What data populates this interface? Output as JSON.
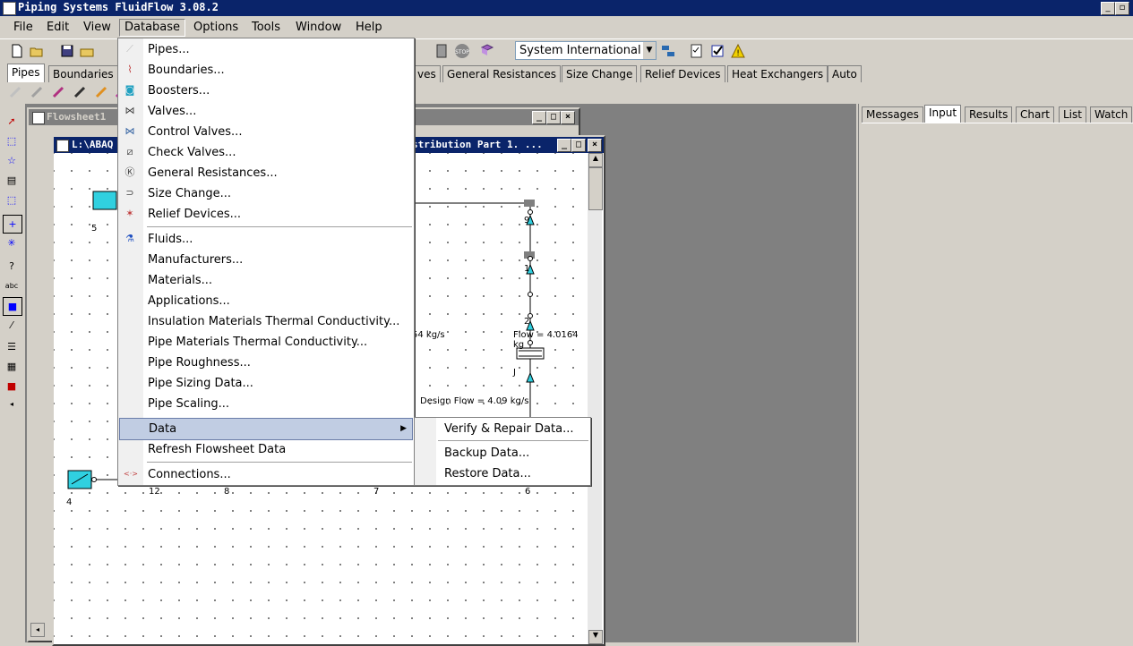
{
  "app": {
    "title": "Piping Systems FluidFlow 3.08.2"
  },
  "menubar": {
    "items": [
      "File",
      "Edit",
      "View",
      "Database",
      "Options",
      "Tools",
      "Window",
      "Help"
    ]
  },
  "toolbar": {
    "units_value": "System International"
  },
  "component_tabs": [
    "Pipes",
    "Boundaries",
    "ves",
    "General Resistances",
    "Size Change",
    "Relief Devices",
    "Heat Exchangers",
    "Auto"
  ],
  "flowsheet1": {
    "title": "Flowsheet1"
  },
  "flowsheet2": {
    "title_left": "L:\\ABAQ",
    "title_right": "stribution Part 1. ...",
    "labels": {
      "n5": "5",
      "n9": "9",
      "n1": "1",
      "n2": "2",
      "nJ": "J",
      "flow_a": "54 kg/s",
      "flow_b": "Flow = 4.0164 kg",
      "design_flow": "Design Flow = 4.09 kg/s",
      "n4": "4",
      "n12": "12",
      "n8": "8",
      "n7": "7",
      "n6": "6"
    }
  },
  "right_panel": {
    "tabs": [
      "Messages",
      "Input",
      "Results",
      "Chart",
      "List",
      "Watch"
    ]
  },
  "database_menu": {
    "items": [
      {
        "label": "Pipes...",
        "icon": "pipe-icon"
      },
      {
        "label": "Boundaries...",
        "icon": "boundary-icon"
      },
      {
        "label": "Boosters...",
        "icon": "booster-icon"
      },
      {
        "label": "Valves...",
        "icon": "valve-icon"
      },
      {
        "label": "Control Valves...",
        "icon": "control-valve-icon"
      },
      {
        "label": "Check Valves...",
        "icon": "check-valve-icon"
      },
      {
        "label": "General Resistances...",
        "icon": "resistance-icon"
      },
      {
        "label": "Size Change...",
        "icon": "size-change-icon"
      },
      {
        "label": "Relief Devices...",
        "icon": "relief-icon"
      },
      {
        "label": "Fluids...",
        "icon": "fluid-icon"
      },
      {
        "label": "Manufacturers...",
        "icon": ""
      },
      {
        "label": "Materials...",
        "icon": ""
      },
      {
        "label": "Applications...",
        "icon": ""
      },
      {
        "label": "Insulation Materials Thermal Conductivity...",
        "icon": ""
      },
      {
        "label": "Pipe Materials Thermal Conductivity...",
        "icon": ""
      },
      {
        "label": "Pipe Roughness...",
        "icon": ""
      },
      {
        "label": "Pipe Sizing Data...",
        "icon": ""
      },
      {
        "label": "Pipe Scaling...",
        "icon": ""
      },
      {
        "label": "Data",
        "icon": ""
      },
      {
        "label": "Refresh Flowsheet Data",
        "icon": ""
      },
      {
        "label": "Connections...",
        "icon": "connections-icon"
      }
    ]
  },
  "data_submenu": {
    "items": [
      "Verify & Repair Data...",
      "Backup Data...",
      "Restore Data..."
    ]
  }
}
